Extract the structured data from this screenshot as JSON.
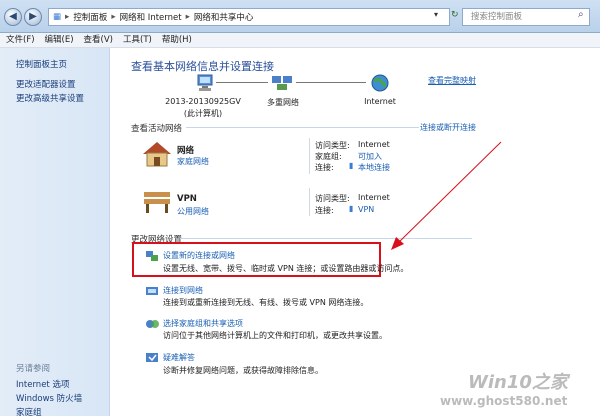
{
  "address": {
    "breadcrumbs": [
      "控制面板",
      "网络和 Internet",
      "网络和共享中心"
    ],
    "search_placeholder": "搜索控制面板"
  },
  "menu": [
    "文件(F)",
    "编辑(E)",
    "查看(V)",
    "工具(T)",
    "帮助(H)"
  ],
  "sidebar": {
    "items": [
      "控制面板主页",
      "更改适配器设置",
      "更改高级共享设置"
    ],
    "see_also": "另请参阅",
    "see_also_items": [
      "Internet 选项",
      "Windows 防火墙",
      "家庭组"
    ]
  },
  "main": {
    "title": "查看基本网络信息并设置连接",
    "map_link": "查看完整映射",
    "map_nodes": [
      {
        "label": "2013-20130925GV",
        "sub": "(此计算机)"
      },
      {
        "label": "多重网络"
      },
      {
        "label": "Internet"
      }
    ],
    "active_title": "查看活动网络",
    "connect_link": "连接或断开连接",
    "networks": [
      {
        "name": "网络",
        "type": "家庭网络",
        "access_label": "访问类型:",
        "access": "Internet",
        "group_label": "家庭组:",
        "group": "可加入",
        "conn_label": "连接:",
        "conn": "本地连接"
      },
      {
        "name": "VPN",
        "type": "公用网络",
        "access_label": "访问类型:",
        "access": "Internet",
        "conn_label": "连接:",
        "conn": "VPN"
      }
    ],
    "change_title": "更改网络设置",
    "tasks": [
      {
        "title": "设置新的连接或网络",
        "desc": "设置无线、宽带、拨号、临时或 VPN 连接；或设置路由器或访问点。"
      },
      {
        "title": "连接到网络",
        "desc": "连接到或重新连接到无线、有线、拨号或 VPN 网络连接。"
      },
      {
        "title": "选择家庭组和共享选项",
        "desc": "访问位于其他网络计算机上的文件和打印机，或更改共享设置。"
      },
      {
        "title": "疑难解答",
        "desc": "诊断并修复网络问题，或获得故障排除信息。"
      }
    ]
  },
  "watermark": {
    "brand": "Win10之家",
    "url": "www.ghost580.net"
  }
}
